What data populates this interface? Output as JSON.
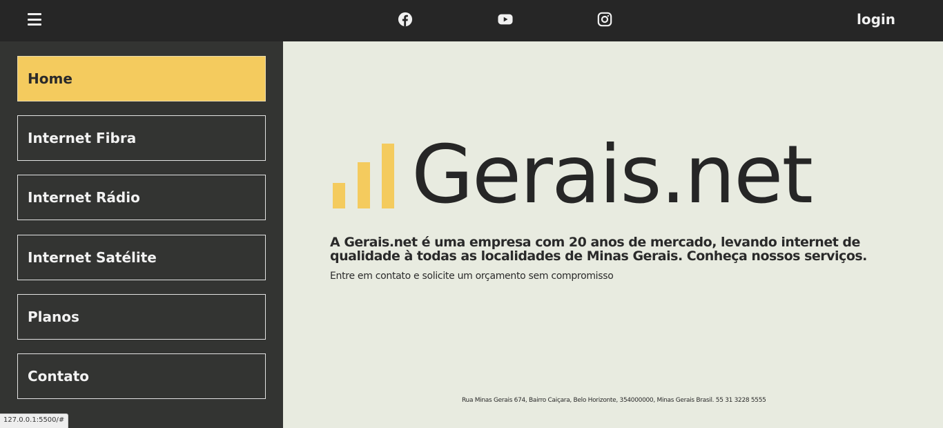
{
  "header": {
    "menu_icon": "hamburger-menu-icon",
    "social": [
      {
        "icon": "facebook-icon"
      },
      {
        "icon": "youtube-icon"
      },
      {
        "icon": "instagram-icon"
      }
    ],
    "login_label": "login"
  },
  "sidebar": {
    "items": [
      {
        "label": "Home",
        "active": true
      },
      {
        "label": "Internet Fibra",
        "active": false
      },
      {
        "label": "Internet Rádio",
        "active": false
      },
      {
        "label": "Internet Satélite",
        "active": false
      },
      {
        "label": "Planos",
        "active": false
      },
      {
        "label": "Contato",
        "active": false
      }
    ]
  },
  "main": {
    "logo_text": "Gerais.net",
    "tagline": "A Gerais.net é uma empresa com 20 anos de mercado, levando internet de qualidade à todas as localidades de Minas Gerais. Conheça nossos serviços.",
    "subtagline": "Entre em contato e solicite um orçamento sem compromisso",
    "address": "Rua Minas Gerais 674, Bairro Caiçara, Belo Horizonte, 354000000, Minas Gerais Brasil. 55 31 3228 5555"
  },
  "status_bar": {
    "url": "127.0.0.1:5500/#"
  },
  "colors": {
    "accent": "#f4cb5e",
    "topbar": "#262626",
    "sidebar": "#333432",
    "background": "#e8ebe0"
  }
}
